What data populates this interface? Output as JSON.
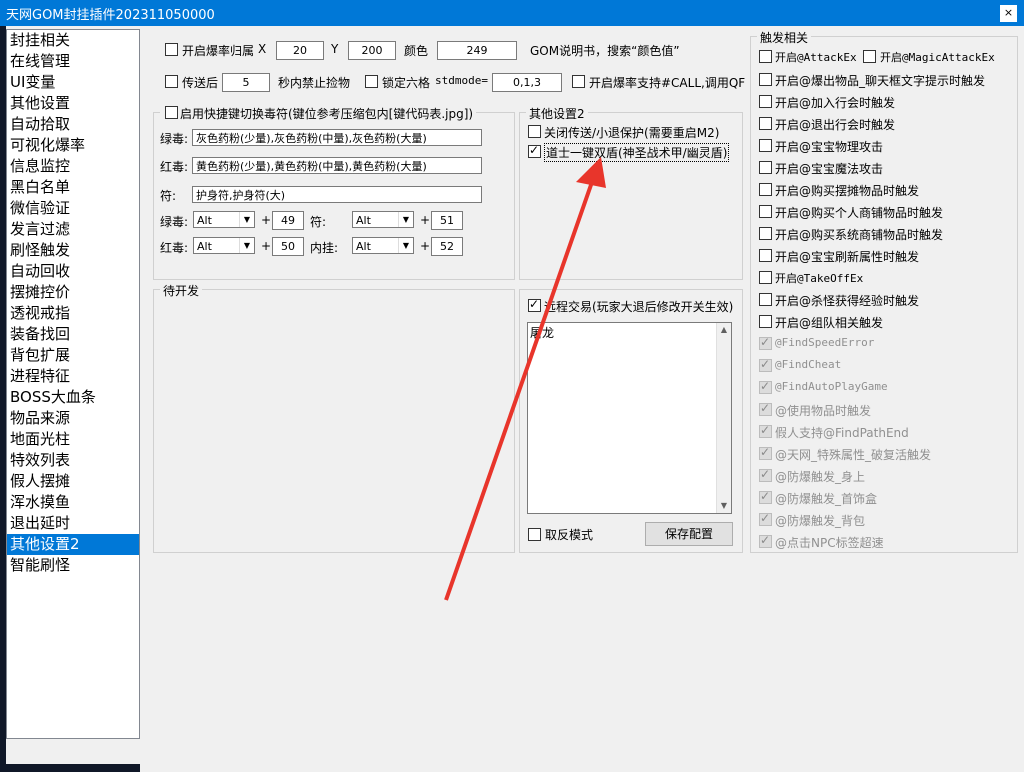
{
  "window": {
    "title": "天网GOM封挂插件202311050000",
    "close": "×"
  },
  "sidebar": {
    "items": [
      "封挂相关",
      "在线管理",
      "UI变量",
      "其他设置",
      "自动拾取",
      "可视化爆率",
      "信息监控",
      "黑白名单",
      "微信验证",
      "发言过滤",
      "刷怪触发",
      "自动回收",
      "摆摊控价",
      "透视戒指",
      "装备找回",
      "背包扩展",
      "进程特征",
      "BOSS大血条",
      "物品来源",
      "地面光柱",
      "特效列表",
      "假人摆摊",
      "浑水摸鱼",
      "退出延时",
      "其他设置2",
      "智能刷怪"
    ],
    "selected_index": 24
  },
  "top": {
    "drop_owner_label": "开启爆率归属",
    "x_label": "X",
    "x_value": "20",
    "y_label": "Y",
    "y_value": "200",
    "color_label": "颜色",
    "color_value": "249",
    "help_text": "GOM说明书，搜索“颜色值”",
    "teleport_label": "传送后",
    "teleport_seconds": "5",
    "teleport_suffix": "秒内禁止捡物",
    "lock_label": "锁定六格",
    "stdmode_label": "stdmode=",
    "stdmode_value": "0,1,3",
    "call_label": "开启爆率支持#CALL,调用QF"
  },
  "poison": {
    "legend": "启用快捷键切换毒符(键位参考压缩包内[键代码表.jpg])",
    "green_label": "绿毒:",
    "green_value": "灰色药粉(少量),灰色药粉(中量),灰色药粉(大量)",
    "red_label": "红毒:",
    "red_value": "黄色药粉(少量),黄色药粉(中量),黄色药粉(大量)",
    "charm_label": "符:",
    "charm_value": "护身符,护身符(大)",
    "keys": [
      {
        "label": "绿毒:",
        "mod": "Alt",
        "plus": "+",
        "code": "49"
      },
      {
        "label": "符:",
        "mod": "Alt",
        "plus": "+",
        "code": "51"
      },
      {
        "label": "红毒:",
        "mod": "Alt",
        "plus": "+",
        "code": "50"
      },
      {
        "label": "内挂:",
        "mod": "Alt",
        "plus": "+",
        "code": "52"
      }
    ]
  },
  "other2": {
    "legend": "其他设置2",
    "items": [
      {
        "label": "关闭传送/小退保护(需要重启M2)",
        "checked": false
      },
      {
        "label": "道士一键双盾(神圣战术甲/幽灵盾)",
        "checked": true
      }
    ]
  },
  "pending": {
    "legend": "待开发"
  },
  "trade": {
    "label": "远程交易(玩家大退后修改开关生效)",
    "checked": true,
    "memo_text": "屠龙",
    "invert_label": "取反模式",
    "save_button": "保存配置"
  },
  "triggers": {
    "legend": "触发相关",
    "row1": [
      {
        "label": "开启@AttackEx",
        "mono": true
      },
      {
        "label": "开启@MagicAttackEx",
        "mono": true
      }
    ],
    "items": [
      {
        "label": "开启@爆出物品_聊天框文字提示时触发",
        "checked": false,
        "disabled": false
      },
      {
        "label": "开启@加入行会时触发",
        "checked": false,
        "disabled": false
      },
      {
        "label": "开启@退出行会时触发",
        "checked": false,
        "disabled": false
      },
      {
        "label": "开启@宝宝物理攻击",
        "checked": false,
        "disabled": false
      },
      {
        "label": "开启@宝宝魔法攻击",
        "checked": false,
        "disabled": false
      },
      {
        "label": "开启@购买摆摊物品时触发",
        "checked": false,
        "disabled": false
      },
      {
        "label": "开启@购买个人商铺物品时触发",
        "checked": false,
        "disabled": false
      },
      {
        "label": "开启@购买系统商铺物品时触发",
        "checked": false,
        "disabled": false
      },
      {
        "label": "开启@宝宝刷新属性时触发",
        "checked": false,
        "disabled": false
      },
      {
        "label": "开启@TakeOffEx",
        "checked": false,
        "disabled": false,
        "mono": true
      },
      {
        "label": "开启@杀怪获得经验时触发",
        "checked": false,
        "disabled": false
      },
      {
        "label": "开启@组队相关触发",
        "checked": false,
        "disabled": false
      },
      {
        "label": "@FindSpeedError",
        "checked": true,
        "disabled": true,
        "mono": true
      },
      {
        "label": "@FindCheat",
        "checked": true,
        "disabled": true,
        "mono": true
      },
      {
        "label": "@FindAutoPlayGame",
        "checked": true,
        "disabled": true,
        "mono": true
      },
      {
        "label": "@使用物品时触发",
        "checked": true,
        "disabled": true
      },
      {
        "label": "假人支持@FindPathEnd",
        "checked": true,
        "disabled": true
      },
      {
        "label": "@天网_特殊属性_破复活触发",
        "checked": true,
        "disabled": true
      },
      {
        "label": "@防爆触发_身上",
        "checked": true,
        "disabled": true
      },
      {
        "label": "@防爆触发_首饰盒",
        "checked": true,
        "disabled": true
      },
      {
        "label": "@防爆触发_背包",
        "checked": true,
        "disabled": true
      },
      {
        "label": "@点击NPC标签超速",
        "checked": true,
        "disabled": true
      }
    ]
  }
}
